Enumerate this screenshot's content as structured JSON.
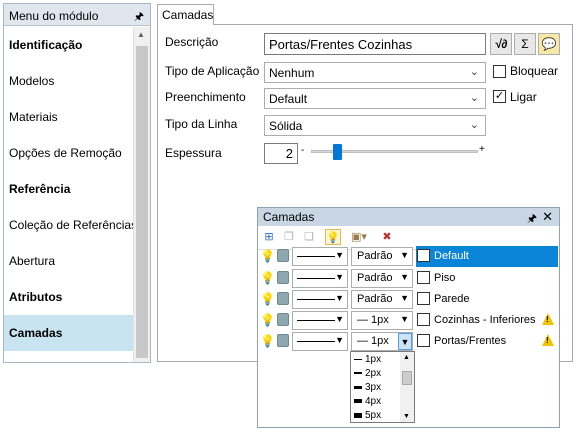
{
  "menu": {
    "title": "Menu do módulo",
    "pin_icon": "pin-icon",
    "items": [
      {
        "label": "Identificação",
        "bold": true,
        "selected": false
      },
      {
        "label": "Modelos",
        "bold": false,
        "selected": false
      },
      {
        "label": "Materiais",
        "bold": false,
        "selected": false
      },
      {
        "label": "Opções de Remoção",
        "bold": false,
        "selected": false
      },
      {
        "label": "Referência",
        "bold": true,
        "selected": false
      },
      {
        "label": "Coleção de Referências",
        "bold": false,
        "selected": false
      },
      {
        "label": "Abertura",
        "bold": false,
        "selected": false
      },
      {
        "label": "Atributos",
        "bold": true,
        "selected": false
      },
      {
        "label": "Camadas",
        "bold": true,
        "selected": true
      }
    ]
  },
  "tab": {
    "label": "Camadas"
  },
  "form": {
    "descricao": {
      "label": "Descrição",
      "value": "Portas/Frentes Cozinhas"
    },
    "tipo_aplicacao": {
      "label": "Tipo de Aplicação",
      "value": "Nenhum"
    },
    "bloquear": {
      "label": "Bloquear",
      "checked": false
    },
    "preenchimento": {
      "label": "Preenchimento",
      "value": "Default"
    },
    "ligar": {
      "label": "Ligar",
      "checked": true,
      "check_glyph": "✓"
    },
    "tipo_linha": {
      "label": "Tipo da Linha",
      "value": "Sólida"
    },
    "espessura": {
      "label": "Espessura",
      "value": "2",
      "minus": "-",
      "plus": "+",
      "slider_fraction": 0.13
    },
    "buttons": {
      "formula": "√∂",
      "sum": "Σ"
    }
  },
  "layers_window": {
    "title": "Camadas",
    "rows": [
      {
        "style": "Padrão",
        "name": "Default",
        "selected": true,
        "warning": false
      },
      {
        "style": "Padrão",
        "name": "Piso",
        "selected": false,
        "warning": false
      },
      {
        "style": "Padrão",
        "name": "Parede",
        "selected": false,
        "warning": false
      },
      {
        "style": "— 1px",
        "name": "Cozinhas - Inferiores",
        "selected": false,
        "warning": true
      },
      {
        "style": "— 1px",
        "name": "Portas/Frentes",
        "selected": false,
        "warning": true
      }
    ],
    "dropdown_options": [
      {
        "label": "1px",
        "weight": 1
      },
      {
        "label": "2px",
        "weight": 2
      },
      {
        "label": "3px",
        "weight": 3
      },
      {
        "label": "4px",
        "weight": 4
      },
      {
        "label": "5px",
        "weight": 5
      }
    ]
  },
  "colors": {
    "selection": "#0a84d6",
    "menu_selected": "#c9e4f1",
    "accent": "#0078d7",
    "warning": "#f0c400"
  }
}
